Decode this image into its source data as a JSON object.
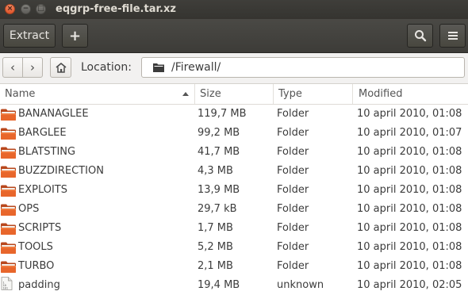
{
  "window": {
    "title": "eqgrp-free-file.tar.xz",
    "close_glyph": "×",
    "minimize_glyph": "−",
    "maximize_glyph": "□"
  },
  "toolbar": {
    "extract_label": "Extract",
    "add_label": "+",
    "search_icon": "search-icon",
    "menu_icon": "hamburger-menu-icon"
  },
  "location": {
    "back_glyph": "‹",
    "forward_glyph": "›",
    "label": "Location:",
    "path": "/Firewall/"
  },
  "columns": {
    "name": "Name",
    "size": "Size",
    "type": "Type",
    "modified": "Modified",
    "sort_column": "Name",
    "sort_direction": "ascending"
  },
  "files": [
    {
      "name": "BANANAGLEE",
      "size": "119,7 MB",
      "type": "Folder",
      "modified": "10 april 2010, 01:08",
      "icon": "folder-icon"
    },
    {
      "name": "BARGLEE",
      "size": "99,2 MB",
      "type": "Folder",
      "modified": "10 april 2010, 01:07",
      "icon": "folder-icon"
    },
    {
      "name": "BLATSTING",
      "size": "41,7 MB",
      "type": "Folder",
      "modified": "10 april 2010, 01:08",
      "icon": "folder-icon"
    },
    {
      "name": "BUZZDIRECTION",
      "size": "4,3 MB",
      "type": "Folder",
      "modified": "10 april 2010, 01:08",
      "icon": "folder-icon"
    },
    {
      "name": "EXPLOITS",
      "size": "13,9 MB",
      "type": "Folder",
      "modified": "10 april 2010, 01:08",
      "icon": "folder-icon"
    },
    {
      "name": "OPS",
      "size": "29,7 kB",
      "type": "Folder",
      "modified": "10 april 2010, 01:08",
      "icon": "folder-icon"
    },
    {
      "name": "SCRIPTS",
      "size": "1,7 MB",
      "type": "Folder",
      "modified": "10 april 2010, 01:08",
      "icon": "folder-icon"
    },
    {
      "name": "TOOLS",
      "size": "5,2 MB",
      "type": "Folder",
      "modified": "10 april 2010, 01:08",
      "icon": "folder-icon"
    },
    {
      "name": "TURBO",
      "size": "2,1 MB",
      "type": "Folder",
      "modified": "10 april 2010, 01:08",
      "icon": "folder-icon"
    },
    {
      "name": "padding",
      "size": "19,4 MB",
      "type": "unknown",
      "modified": "10 april 2010, 02:05",
      "icon": "binary-file-icon"
    }
  ],
  "colors": {
    "titlebar": "#3f3e3a",
    "close_button": "#e95420",
    "folder": "#e8662b"
  }
}
